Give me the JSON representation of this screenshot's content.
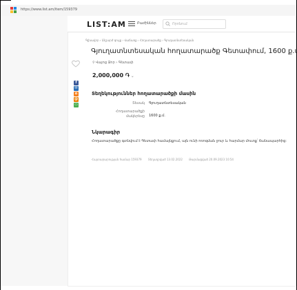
{
  "browser": {
    "url": "https://www.list.am/item/159379"
  },
  "header": {
    "logo": "LIST:AM",
    "menu_label": "Բաժիններ",
    "search_placeholder": "Որոնում"
  },
  "breadcrumbs": "Գլխավոր › Անշարժ գույք › Վաճառք › Հողատարածք › Գյուղատնտեսական",
  "listing": {
    "title": "Գյուղատնտեսական հողատարածք Գետափում, 1600 ք.մ.",
    "location": "Վայոց Ձոր › Գետափ",
    "price": "2,000,000 ֏",
    "price_currency_arrow": "⌄"
  },
  "details": {
    "heading": "Տեղեկություններ հողատարածքի մասին",
    "rows": [
      {
        "label": "Տեսակ",
        "value": "Գյուղատնտեսական"
      },
      {
        "label": "Հողատարածքի մակերեսը",
        "value": "1600 ք.մ."
      }
    ]
  },
  "description": {
    "heading": "Նկարագիր",
    "text": "Հողատարածքը գտնվում է Գետափ համայնքում, այն ունի ոռոգման ջուր և հարմար մուտք՝ ճանապարհից:"
  },
  "meta": {
    "ad_id": "Հայտարարության համար 159379",
    "posted": "Տեղադրված 13.02.2022",
    "renewed": "Թարմացված 20.09.2023 10:54"
  },
  "colors": {
    "facebook": "#3b5998",
    "vk": "#2a6db5",
    "ok": "#f58220",
    "mail": "#eb7e00",
    "whatsapp": "#4caf50"
  }
}
